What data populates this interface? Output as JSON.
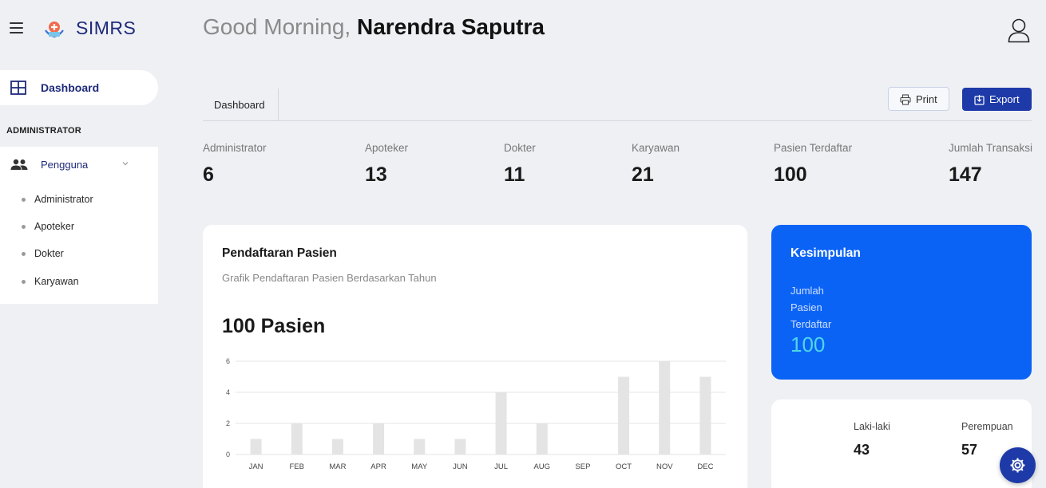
{
  "app": {
    "brand": "SIMRS"
  },
  "sidebar": {
    "dashboard_label": "Dashboard",
    "section_title": "ADMINISTRATOR",
    "group": {
      "label": "Pengguna",
      "items": [
        {
          "label": "Administrator"
        },
        {
          "label": "Apoteker"
        },
        {
          "label": "Dokter"
        },
        {
          "label": "Karyawan"
        }
      ]
    }
  },
  "header": {
    "greeting_prefix": "Good Morning,",
    "user_name": "Narendra Saputra"
  },
  "toolbar": {
    "tab_label": "Dashboard",
    "print_label": "Print",
    "export_label": "Export"
  },
  "stats": [
    {
      "label": "Administrator",
      "value": "6"
    },
    {
      "label": "Apoteker",
      "value": "13"
    },
    {
      "label": "Dokter",
      "value": "11"
    },
    {
      "label": "Karyawan",
      "value": "21"
    },
    {
      "label": "Pasien Terdaftar",
      "value": "100"
    },
    {
      "label": "Jumlah Transaksi",
      "value": "147"
    }
  ],
  "chart_card": {
    "title": "Pendaftaran Pasien",
    "subtitle": "Grafik Pendaftaran Pasien Berdasarkan Tahun",
    "total": "100 Pasien"
  },
  "chart_data": {
    "type": "bar",
    "categories": [
      "JAN",
      "FEB",
      "MAR",
      "APR",
      "MAY",
      "JUN",
      "JUL",
      "AUG",
      "SEP",
      "OCT",
      "NOV",
      "DEC"
    ],
    "values": [
      1,
      2,
      1,
      2,
      1,
      1,
      4,
      2,
      0,
      5,
      6,
      5
    ],
    "ylim": [
      0,
      6
    ],
    "yticks": [
      0,
      2,
      4,
      6
    ],
    "grid": true,
    "bar_color": "#e4e4e4"
  },
  "summary": {
    "title": "Kesimpulan",
    "label": "Jumlah Pasien Terdaftar",
    "value": "100"
  },
  "gender": [
    {
      "label": "Laki-laki",
      "value": "43"
    },
    {
      "label": "Perempuan",
      "value": "57"
    }
  ],
  "colors": {
    "brand": "#1e2a7a",
    "accent": "#1e3aa8",
    "summary_bg": "#0b63f6",
    "summary_value": "#4dd8e8"
  },
  "icons": {
    "menu": "hamburger-icon",
    "logo": "hospital-logo-icon",
    "dashboard": "grid-icon",
    "users": "people-icon",
    "profile": "user-icon",
    "print": "printer-icon",
    "export": "export-icon",
    "settings": "gear-icon"
  }
}
